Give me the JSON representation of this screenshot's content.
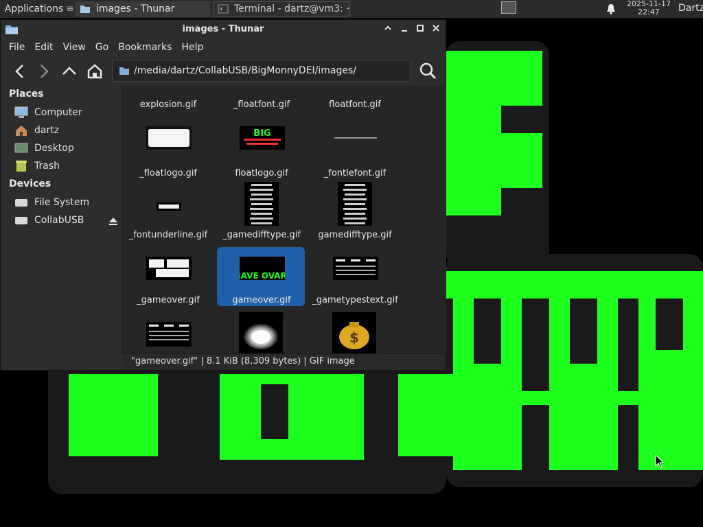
{
  "panel": {
    "apps_label": "Applications",
    "tasks": [
      {
        "label": "images - Thunar",
        "icon": "folder-icon"
      },
      {
        "label": "Terminal - dartz@vm3: ~",
        "icon": "terminal-icon"
      }
    ],
    "clock_date": "2025-11-17",
    "clock_time": "22:47",
    "user": "Dartz"
  },
  "window": {
    "title": "images - Thunar",
    "menu": [
      "File",
      "Edit",
      "View",
      "Go",
      "Bookmarks",
      "Help"
    ],
    "location": "/media/dartz/CollabUSB/BigMonnyDEI/images/"
  },
  "sidebar": {
    "places_heading": "Places",
    "places": [
      {
        "label": "Computer",
        "icon": "computer-icon"
      },
      {
        "label": "dartz",
        "icon": "home-folder-icon"
      },
      {
        "label": "Desktop",
        "icon": "desktop-icon"
      },
      {
        "label": "Trash",
        "icon": "trash-icon"
      }
    ],
    "devices_heading": "Devices",
    "devices": [
      {
        "label": "File System",
        "icon": "drive-icon"
      },
      {
        "label": "CollabUSB",
        "icon": "usb-drive-icon"
      }
    ]
  },
  "files": [
    {
      "name": "explosion.gif"
    },
    {
      "name": "_floatfont.gif"
    },
    {
      "name": "floatfont.gif"
    },
    {
      "name": "_floatlogo.gif"
    },
    {
      "name": "floatlogo.gif"
    },
    {
      "name": "_fontlefont.gif"
    },
    {
      "name": "_fontunderline.gif"
    },
    {
      "name": "_gamedifftype.gif"
    },
    {
      "name": "gamedifftype.gif"
    },
    {
      "name": "_gameover.gif"
    },
    {
      "name": "gameover.gif",
      "selected": true
    },
    {
      "name": "_gametypestext.gif"
    },
    {
      "name": "",
      "icon": "image-thumbnail"
    },
    {
      "name": "",
      "icon": "white-bag-icon"
    },
    {
      "name": "",
      "icon": "money-bag-icon"
    }
  ],
  "thumbnail_text": {
    "floatlogo": "BIG",
    "gameover": "GAVE OVAR!"
  },
  "statusbar": "\"gameover.gif\"  |  8.1 KiB (8,309 bytes)  |  GIF image",
  "wallpaper_text": "GAVE OVAR!",
  "colors": {
    "accent": "#2160a8",
    "wallpaper_green": "#1dff1d"
  }
}
